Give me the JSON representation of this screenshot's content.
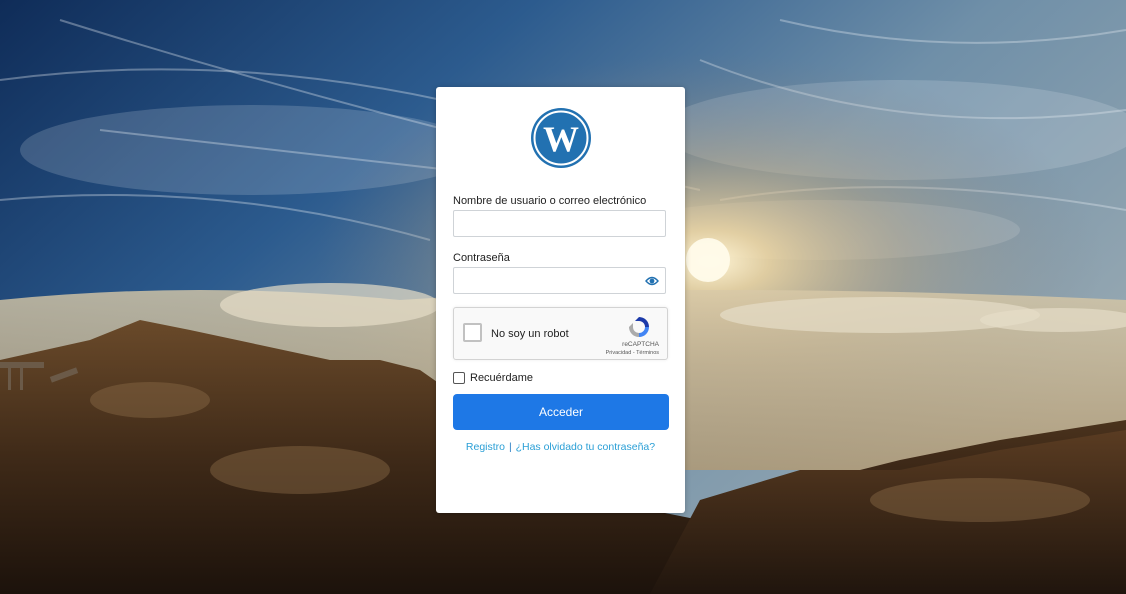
{
  "login": {
    "username_label": "Nombre de usuario o correo electrónico",
    "username_value": "",
    "password_label": "Contraseña",
    "password_value": "",
    "remember_label": "Recuérdame",
    "submit_label": "Acceder"
  },
  "recaptcha": {
    "label": "No soy un robot",
    "brand": "reCAPTCHA",
    "links": "Privacidad - Términos"
  },
  "footer": {
    "register_link": "Registro",
    "separator": "|",
    "lost_password_link": "¿Has olvidado tu contraseña?"
  },
  "colors": {
    "accent": "#1e78e6",
    "link": "#2a9fd6",
    "wordpress_blue": "#2271b1"
  },
  "icons": {
    "logo": "wordpress-logo",
    "password_toggle": "eye-icon",
    "captcha": "recaptcha-logo"
  }
}
